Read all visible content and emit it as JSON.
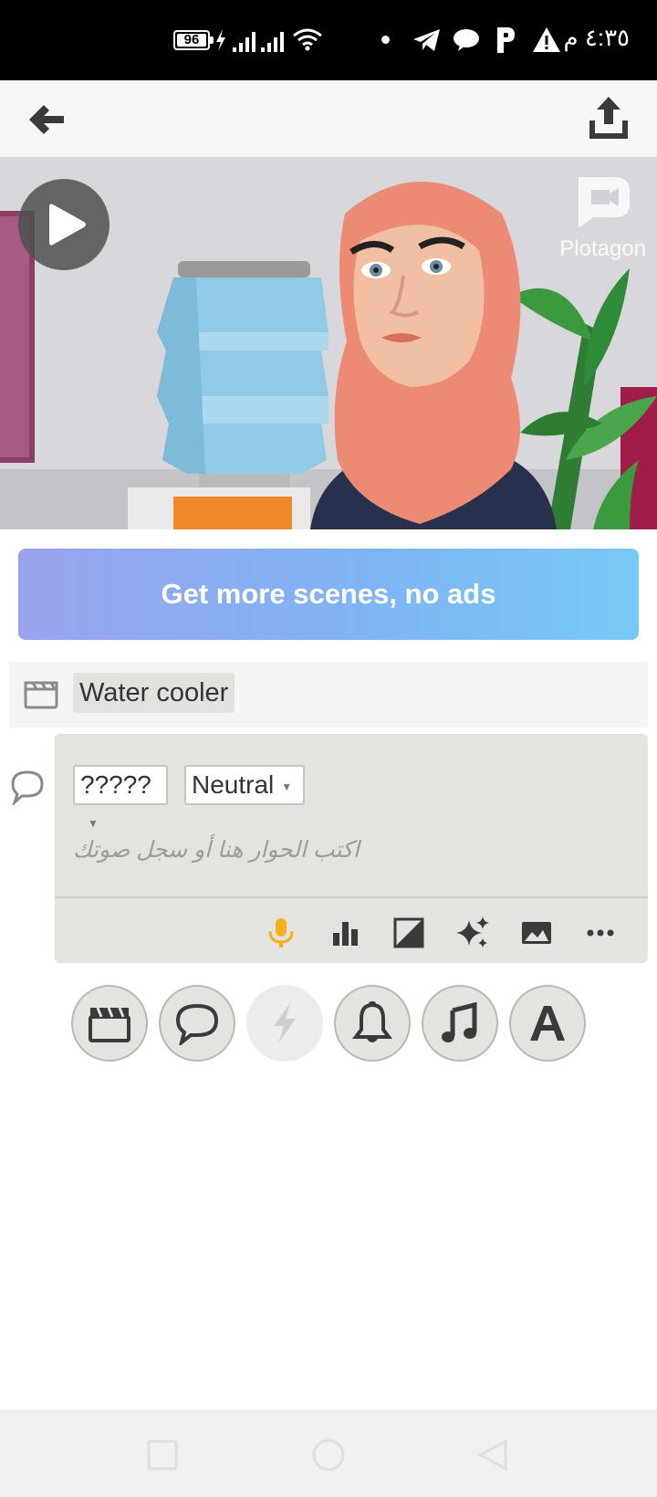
{
  "status_bar": {
    "battery": "96",
    "time": "٤:٣٥ م"
  },
  "app_bar": {
    "back_icon": "arrow-left-icon",
    "share_icon": "export-icon"
  },
  "scene": {
    "watermark": "Plotagon"
  },
  "banner": {
    "label": "Get more scenes, no ads"
  },
  "location": {
    "label": "Water cooler"
  },
  "dialogue": {
    "character": "?????",
    "emotion": "Neutral",
    "placeholder": "اكتب الحوار هنا أو سجل صوتك",
    "toolbar": [
      "mic-icon",
      "bar-chart-icon",
      "contrast-icon",
      "sparkle-icon",
      "image-icon",
      "more-icon"
    ],
    "mic_color": "#f5b01a"
  },
  "add_buttons": [
    "scene-icon",
    "dialogue-icon",
    "action-icon",
    "sound-icon",
    "music-icon",
    "text-icon"
  ]
}
